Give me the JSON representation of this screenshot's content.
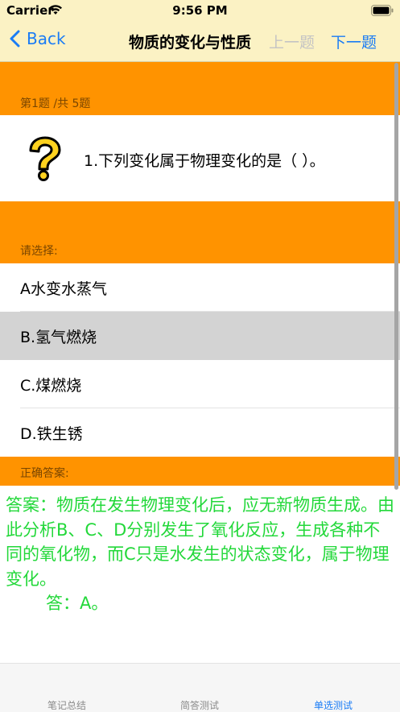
{
  "status": {
    "carrier": "Carrier",
    "time": "9:56 PM"
  },
  "nav": {
    "back": "Back",
    "title": "物质的变化与性质",
    "prev": "上一题",
    "next": "下一题"
  },
  "progress": "第1题 /共 5题",
  "question": {
    "text": "1.下列变化属于物理变化的是（  ）。",
    "icon": "question-mark-icon"
  },
  "choose_label": "请选择:",
  "options": [
    "A水变水蒸气",
    "B.氢气燃烧",
    "C.煤燃烧",
    "D.铁生锈"
  ],
  "selected_index": 1,
  "answer_label": "正确答案:",
  "answer": {
    "line1": "答案：物质在发生物理变化后，应无新物质生成。由此分析B、C、D分别发生了氧化反应，生成各种不同的氧化物，而C只是水发生的状态变化，属于物理变化。",
    "line2": "答：A。"
  },
  "tabs": [
    "笔记总结",
    "简答测试",
    "单选测试"
  ],
  "active_tab": 2,
  "colors": {
    "orange": "#ff9300",
    "answer_green": "#23d83a",
    "link_blue": "#1a7cf5",
    "nav_bg": "#fbf2c4"
  }
}
